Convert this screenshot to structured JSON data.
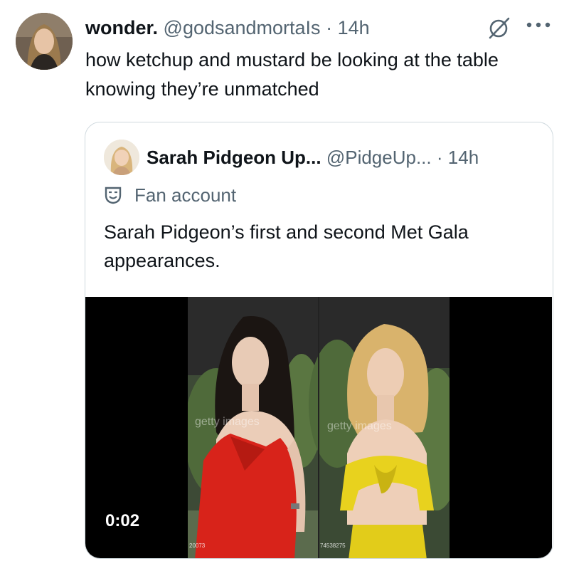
{
  "tweet": {
    "author_name": "wonder.",
    "handle": "@godsandmortaIs",
    "separator": "·",
    "time": "14h",
    "text": "how ketchup and mustard be looking at the table knowing they’re unmatched",
    "icons": {
      "grok": "grok-slash-icon",
      "more": "more-dots-icon"
    }
  },
  "quoted": {
    "author_name": "Sarah Pidgeon Up...",
    "handle": "@PidgeUp...",
    "separator": "·",
    "time": "14h",
    "label_icon": "theater-masks-icon",
    "label": "Fan account",
    "text": "Sarah Pidgeon’s first and second Met Gala appearances.",
    "video": {
      "timestamp": "0:02",
      "watermark_left": "getty images",
      "watermark_right": "getty images",
      "id_left": "20073",
      "id_right": "74538275"
    }
  },
  "colors": {
    "text_primary": "#0f1419",
    "text_secondary": "#536471",
    "card_border": "#cfd9de",
    "dress_left": "#d8231a",
    "dress_right": "#e8d21e"
  }
}
